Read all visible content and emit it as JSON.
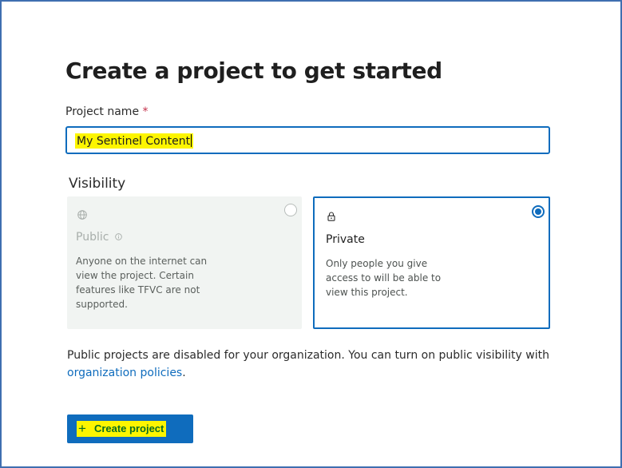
{
  "page": {
    "title": "Create a project to get started"
  },
  "project_name": {
    "label": "Project name",
    "required_marker": "*",
    "value": "My Sentinel Content"
  },
  "visibility": {
    "label": "Visibility",
    "selected": "private",
    "options": [
      {
        "id": "public",
        "icon": "globe-icon",
        "title": "Public",
        "has_info_icon": true,
        "description": "Anyone on the internet can view the project. Certain features like TFVC are not supported.",
        "disabled": true
      },
      {
        "id": "private",
        "icon": "lock-icon",
        "title": "Private",
        "description": "Only people you give access to will be able to view this project.",
        "disabled": false
      }
    ]
  },
  "notice": {
    "text": "Public projects are disabled for your organization. You can turn on public visibility with",
    "link_text": "organization policies",
    "suffix": "."
  },
  "create_button": {
    "icon": "plus-icon",
    "label": "Create project"
  },
  "colors": {
    "accent": "#0f6cbd",
    "highlight": "#fdf500",
    "required": "#c4314b",
    "frame_border": "#3f6fb0"
  }
}
